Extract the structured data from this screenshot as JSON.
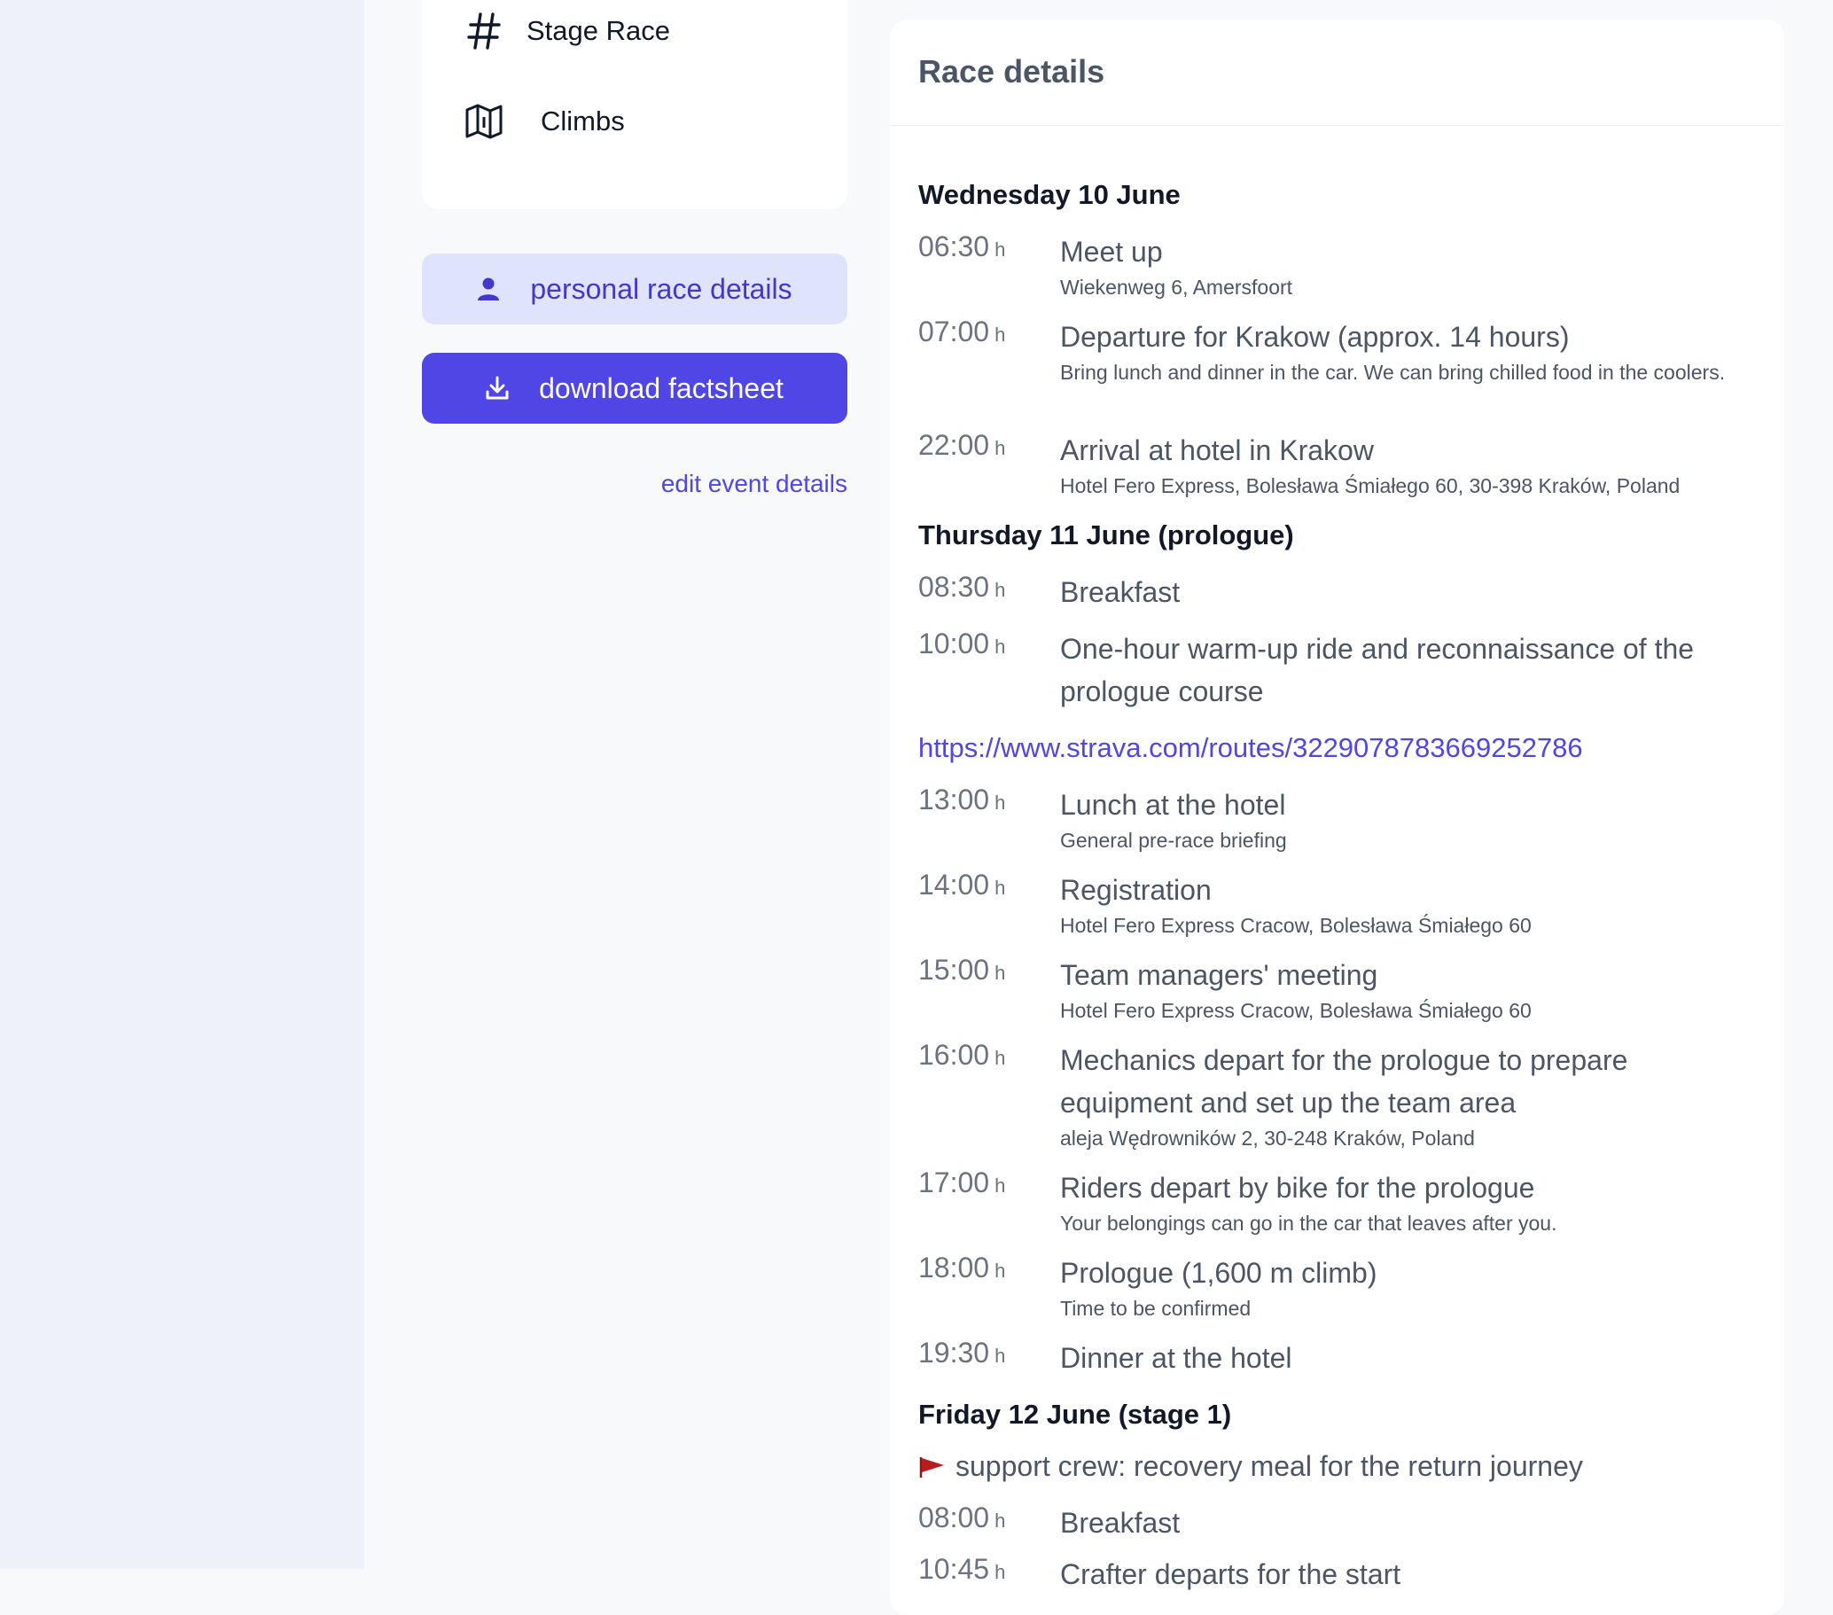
{
  "sidebar": {
    "categories": [
      {
        "label": "Stage Race",
        "icon": "hashtag-icon"
      },
      {
        "label": "Climbs",
        "icon": "map-icon"
      }
    ],
    "personal_button": "personal race details",
    "download_button": "download factsheet",
    "edit_link": "edit event details"
  },
  "panel": {
    "title": "Race details",
    "days": [
      {
        "label": "Wednesday 10 June"
      },
      {
        "label": "Thursday 11 June (prologue)"
      },
      {
        "label": "Friday 12 June (stage 1)"
      }
    ],
    "entries": [
      {
        "time": "06:30",
        "unit": "h",
        "title": "Meet up",
        "sub": "Wiekenweg 6, Amersfoort"
      },
      {
        "time": "07:00",
        "unit": "h",
        "title": "Departure for Krakow (approx. 14 hours)",
        "sub": "Bring lunch and dinner in the car. We can bring chilled food in the coolers."
      },
      {
        "time": "22:00",
        "unit": "h",
        "title": "Arrival at hotel in Krakow",
        "sub": "Hotel Fero Express, Bolesława Śmiałego 60, 30-398 Kraków, Poland"
      },
      {
        "time": "08:30",
        "unit": "h",
        "title": "Breakfast"
      },
      {
        "time": "10:00",
        "unit": "h",
        "title": "One-hour warm-up ride and reconnaissance of the prologue course"
      },
      {
        "time": "13:00",
        "unit": "h",
        "title": "Lunch at the hotel",
        "sub": "General pre-race briefing"
      },
      {
        "time": "14:00",
        "unit": "h",
        "title": "Registration",
        "sub": "Hotel Fero Express Cracow, Bolesława Śmiałego 60"
      },
      {
        "time": "15:00",
        "unit": "h",
        "title": "Team managers' meeting",
        "sub": "Hotel Fero Express Cracow, Bolesława Śmiałego 60"
      },
      {
        "time": "16:00",
        "unit": "h",
        "title": "Mechanics depart for the prologue to prepare equipment and set up the team area",
        "sub": "aleja Wędrowników 2, 30-248 Kraków, Poland"
      },
      {
        "time": "17:00",
        "unit": "h",
        "title": "Riders depart by bike for the prologue",
        "sub": "Your belongings can go in the car that leaves after you."
      },
      {
        "time": "18:00",
        "unit": "h",
        "title": "Prologue (1,600 m climb)",
        "sub": "Time to be confirmed"
      },
      {
        "time": "19:30",
        "unit": "h",
        "title": "Dinner at the hotel"
      },
      {
        "time": "08:00",
        "unit": "h",
        "title": "Breakfast"
      },
      {
        "time": "10:45",
        "unit": "h",
        "title": "Crafter departs for the start"
      }
    ],
    "strava_link": "https://www.strava.com/routes/3229078783669252786",
    "support_note": "support crew: recovery meal for the return journey"
  },
  "colors": {
    "accent": "#4f46e5",
    "accent_light": "#e0e3fc",
    "flag": "#b91c1c"
  }
}
